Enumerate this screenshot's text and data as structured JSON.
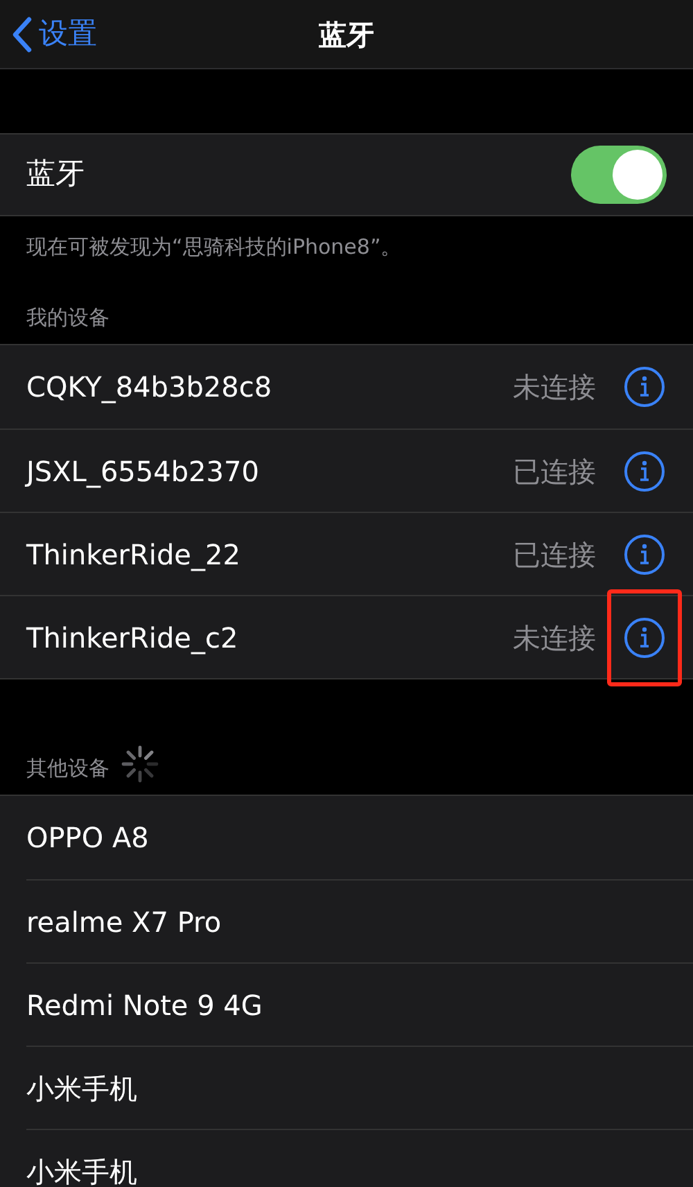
{
  "nav": {
    "back": "设置",
    "title": "蓝牙"
  },
  "bluetooth": {
    "label": "蓝牙",
    "on": true
  },
  "caption": "现在可被发现为“思骑科技的iPhone8”。",
  "my_devices": {
    "header": "我的设备",
    "items": [
      {
        "name": "CQKY_84b3b28c8",
        "status": "未连接",
        "highlighted": false
      },
      {
        "name": "JSXL_6554b2370",
        "status": "已连接",
        "highlighted": false
      },
      {
        "name": "ThinkerRide_22",
        "status": "已连接",
        "highlighted": false
      },
      {
        "name": "ThinkerRide_c2",
        "status": "未连接",
        "highlighted": true
      }
    ]
  },
  "other_devices": {
    "header": "其他设备",
    "searching": true,
    "items": [
      {
        "name": "OPPO A8"
      },
      {
        "name": "realme X7 Pro"
      },
      {
        "name": "Redmi Note 9 4G"
      },
      {
        "name": "小米手机"
      },
      {
        "name": "小米手机"
      }
    ]
  }
}
